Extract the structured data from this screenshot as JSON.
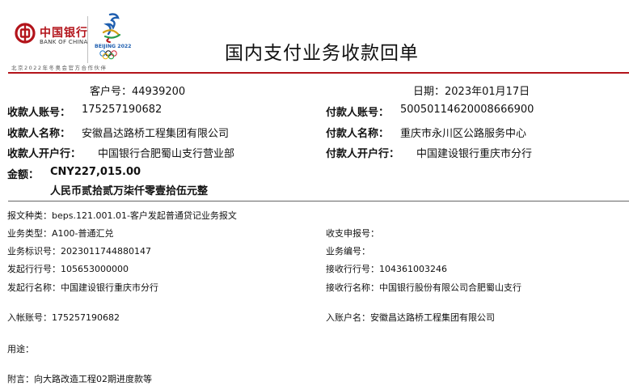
{
  "header": {
    "bank_name_cn": "中国银行",
    "bank_name_en": "BANK OF CHINA",
    "olympic_text": "BEIJING 2022",
    "partner_line": "北京2022年冬奥会官方合作伙伴",
    "title": "国内支付业务收款回单",
    "brand_red": "#b3141b"
  },
  "summary": {
    "customer_no_label": "客户号：",
    "customer_no": "44939200",
    "date_label": "日期：",
    "date": "2023年01月17日"
  },
  "payee": {
    "account_label": "收款人账号：",
    "account": "175257190682",
    "name_label": "收款人名称：",
    "name": "安徽昌达路桥工程集团有限公司",
    "bank_label": "收款人开户行：",
    "bank": "中国银行合肥蜀山支行营业部"
  },
  "payer": {
    "account_label": "付款人账号：",
    "account": "50050114620008666900",
    "name_label": "付款人名称：",
    "name": "重庆市永川区公路服务中心",
    "bank_label": "付款人开户行：",
    "bank": "中国建设银行重庆市分行"
  },
  "amount": {
    "label": "金额：",
    "value": "CNY227,015.00",
    "words": "人民币贰拾贰万柒仟零壹拾伍元整"
  },
  "details": {
    "msg_type_label": "报文种类：",
    "msg_type": "beps.121.001.01-客户发起普通贷记业务报文",
    "receipt_no_label": "收支申报号：",
    "receipt_no": "",
    "biz_type_label": "业务类型：",
    "biz_type": "A100-普通汇兑",
    "biz_code_label": "业务编号：",
    "biz_code": "",
    "biz_id_label": "业务标识号：",
    "biz_id": "2023011744880147",
    "recv_bank_no_label": "接收行行号：",
    "recv_bank_no": "104361003246",
    "orig_bank_no_label": "发起行行号：",
    "orig_bank_no": "105653000000",
    "orig_bank_name_label": "发起行名称：",
    "orig_bank_name": "中国建设银行重庆市分行",
    "recv_bank_name_label": "接收行名称：",
    "recv_bank_name": "中国银行股份有限公司合肥蜀山支行",
    "in_account_label": "入帐账号：",
    "in_account": "175257190682",
    "in_account_name_label": "入账户名：",
    "in_account_name": "安徽昌达路桥工程集团有限公司",
    "purpose_label": "用途：",
    "purpose": "",
    "remark_label": "附言：",
    "remark": "向大路改造工程02期进度款等"
  }
}
